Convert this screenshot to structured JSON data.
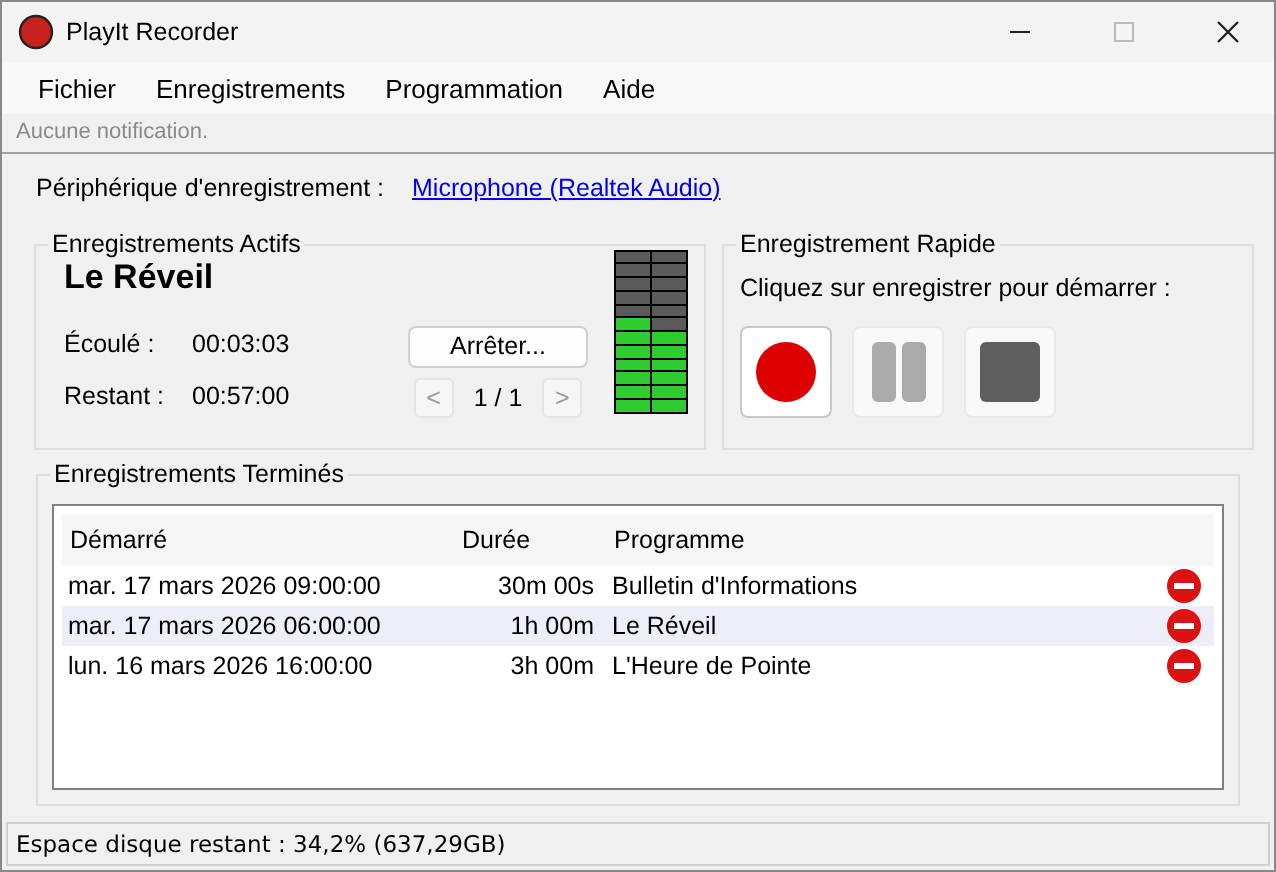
{
  "window": {
    "title": "PlayIt Recorder"
  },
  "menu": [
    "Fichier",
    "Enregistrements",
    "Programmation",
    "Aide"
  ],
  "notification": "Aucune notification.",
  "device": {
    "label": "Périphérique d'enregistrement :",
    "link": "Microphone (Realtek Audio)"
  },
  "active": {
    "title": "Enregistrements Actifs",
    "program": "Le Réveil",
    "elapsed_label": "Écoulé :",
    "elapsed": "00:03:03",
    "remaining_label": "Restant :",
    "remaining": "00:57:00",
    "stop_button": "Arrêter...",
    "prev": {
      "label": "<",
      "disabled": true
    },
    "page": "1 / 1",
    "next": {
      "label": ">",
      "disabled": true
    },
    "meter": [
      {
        "level": 0.58
      },
      {
        "level": 0.5
      }
    ]
  },
  "quick": {
    "title": "Enregistrement Rapide",
    "hint": "Cliquez sur enregistrer pour démarrer :",
    "buttons": [
      {
        "kind": "record",
        "disabled": false
      },
      {
        "kind": "pause",
        "disabled": true
      },
      {
        "kind": "stop",
        "disabled": true
      }
    ]
  },
  "finished": {
    "title": "Enregistrements Terminés",
    "columns": [
      "Démarré",
      "Durée",
      "Programme"
    ],
    "rows": [
      {
        "started": "mar. 17 mars 2026 09:00:00",
        "duration": "30m 00s",
        "program": "Bulletin d'Informations",
        "selected": false
      },
      {
        "started": "mar. 17 mars 2026 06:00:00",
        "duration": "1h 00m",
        "program": "Le Réveil",
        "selected": true
      },
      {
        "started": "lun. 16 mars 2026 16:00:00",
        "duration": "3h 00m",
        "program": "L'Heure de Pointe",
        "selected": false
      }
    ]
  },
  "status_bar": "Espace disque restant : 34,2% (637,29GB)"
}
